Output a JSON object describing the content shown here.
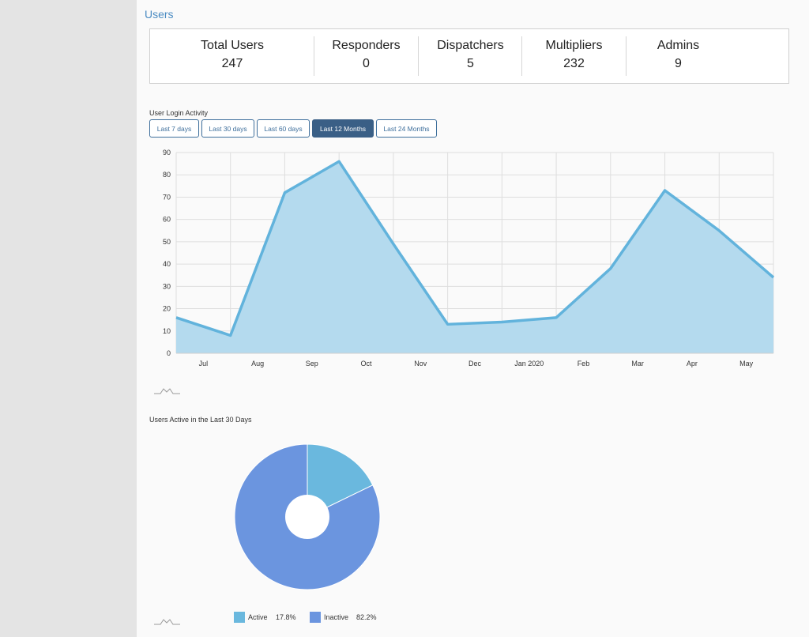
{
  "section_title": "Users",
  "stats": [
    {
      "label": "Total Users",
      "value": "247"
    },
    {
      "label": "Responders",
      "value": "0"
    },
    {
      "label": "Dispatchers",
      "value": "5"
    },
    {
      "label": "Multipliers",
      "value": "232"
    },
    {
      "label": "Admins",
      "value": "9"
    }
  ],
  "login_chart_title": "User Login Activity",
  "range_buttons": [
    "Last 7 days",
    "Last 30 days",
    "Last 60 days",
    "Last 12 Months",
    "Last 24 Months"
  ],
  "active_range": "Last 12 Months",
  "active_chart_title": "Users Active in the Last 30 Days",
  "icons": [
    "sparkline-icon",
    "sparkline-icon"
  ],
  "colors": {
    "line": "#62b3dc",
    "area": "#b4daee",
    "active": "#6ab8de",
    "inactive": "#6b95df",
    "button_active": "#3a5f86"
  },
  "chart_data": [
    {
      "type": "area",
      "title": "",
      "x": [
        "",
        "Jul",
        "Aug",
        "Sep",
        "Oct",
        "Nov",
        "Dec",
        "Jan 2020",
        "Feb",
        "Mar",
        "Apr",
        "May",
        ""
      ],
      "y": [
        16,
        8,
        72,
        86,
        49,
        13,
        14,
        16,
        38,
        73,
        55,
        34
      ],
      "ylim": [
        0,
        90
      ],
      "yticks": [
        0,
        10,
        20,
        30,
        40,
        50,
        60,
        70,
        80,
        90
      ],
      "grid": true
    },
    {
      "type": "pie",
      "title": "",
      "labels": [
        "Active",
        "Inactive"
      ],
      "values": [
        17.8,
        82.2
      ],
      "value_labels": [
        "17.8%",
        "82.2%"
      ]
    }
  ]
}
